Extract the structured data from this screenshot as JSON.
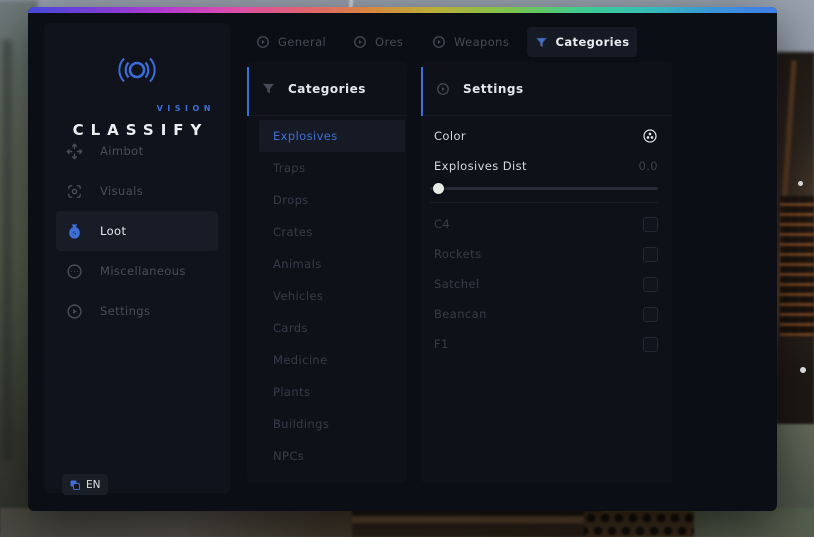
{
  "brand": {
    "vision": "VISION",
    "classify": "CLASSIFY"
  },
  "colors": {
    "accent_blue": "#3e6fd6",
    "window_bg": "#0b0e14",
    "panel_bg": "#0e1118",
    "sidebar_bg": "#10131b",
    "active_row_bg": "#181c26",
    "dim_text": "#454b57",
    "bright_text": "#e8eaee",
    "slider_thumb": "#e4ebe2",
    "gradient_bar": [
      "#4348d8",
      "#b23bd0",
      "#e0636f",
      "#d6883f",
      "#7ec34a",
      "#3ecb90",
      "#3f7ce8"
    ]
  },
  "tabs": [
    {
      "label": "General",
      "icon": "circle-play-icon",
      "active": false
    },
    {
      "label": "Ores",
      "icon": "circle-play-icon",
      "active": false
    },
    {
      "label": "Weapons",
      "icon": "circle-play-icon",
      "active": false
    },
    {
      "label": "Categories",
      "icon": "filter-icon",
      "active": true
    }
  ],
  "sidebar": {
    "items": [
      {
        "label": "Aimbot",
        "icon": "crosshair-icon",
        "active": false
      },
      {
        "label": "Visuals",
        "icon": "eye-scan-icon",
        "active": false
      },
      {
        "label": "Loot",
        "icon": "money-bag-icon",
        "active": true
      },
      {
        "label": "Miscellaneous",
        "icon": "globe-dots-icon",
        "active": false
      },
      {
        "label": "Settings",
        "icon": "circle-play-icon",
        "active": false
      }
    ],
    "language": {
      "label": "EN",
      "icon": "translate-icon"
    }
  },
  "categories_panel": {
    "title": "Categories",
    "icon": "filter-icon",
    "items": [
      {
        "label": "Explosives",
        "selected": true
      },
      {
        "label": "Traps",
        "selected": false
      },
      {
        "label": "Drops",
        "selected": false
      },
      {
        "label": "Crates",
        "selected": false
      },
      {
        "label": "Animals",
        "selected": false
      },
      {
        "label": "Vehicles",
        "selected": false
      },
      {
        "label": "Cards",
        "selected": false
      },
      {
        "label": "Medicine",
        "selected": false
      },
      {
        "label": "Plants",
        "selected": false
      },
      {
        "label": "Buildings",
        "selected": false
      },
      {
        "label": "NPCs",
        "selected": false
      }
    ]
  },
  "settings_panel": {
    "title": "Settings",
    "icon": "circle-play-icon",
    "color_row": {
      "label": "Color",
      "icon": "color-wheel-icon"
    },
    "slider_row": {
      "label": "Explosives Dist",
      "value": "0.0",
      "percent": 2
    },
    "checkboxes": [
      {
        "label": "C4",
        "checked": false
      },
      {
        "label": "Rockets",
        "checked": false
      },
      {
        "label": "Satchel",
        "checked": false
      },
      {
        "label": "Beancan",
        "checked": false
      },
      {
        "label": "F1",
        "checked": false
      }
    ]
  }
}
